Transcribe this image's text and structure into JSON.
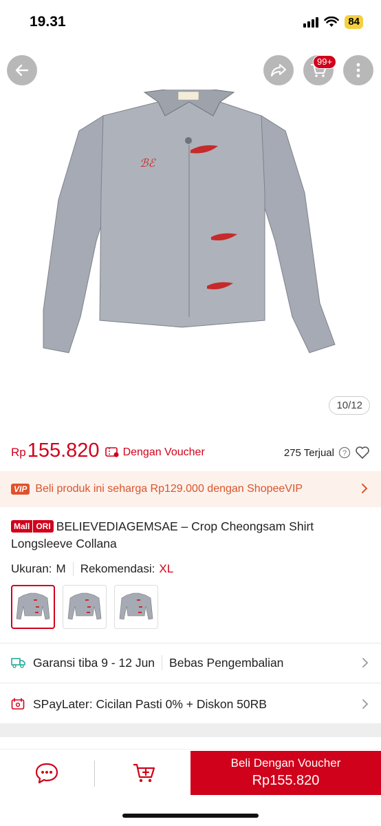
{
  "status": {
    "time": "19.31",
    "battery": "84"
  },
  "header": {
    "cart_badge": "99+",
    "image_counter": "10/12"
  },
  "price": {
    "currency": "Rp",
    "value": "155.820",
    "voucher_label": "Dengan Voucher",
    "sold": "275 Terjual"
  },
  "vip": {
    "tag": "VIP",
    "text": "Beli produk ini seharga Rp129.000 dengan ShopeeVIP"
  },
  "product": {
    "badge_mall": "Mall",
    "badge_ori": "ORI",
    "title": "BELIEVEDIAGEMSAE – Crop Cheongsam Shirt Longsleeve Collana"
  },
  "size": {
    "label": "Ukuran:",
    "value": "M",
    "rec_label": "Rekomendasi:",
    "rec_value": "XL"
  },
  "shipping": {
    "text": "Garansi tiba 9 - 12 Jun",
    "returns": "Bebas Pengembalian"
  },
  "paylater": {
    "text": "SPayLater: Cicilan Pasti 0% + Diskon 50RB"
  },
  "bottom": {
    "buy_label": "Beli Dengan Voucher",
    "buy_price": "Rp155.820"
  },
  "colors": {
    "accent": "#d0011b",
    "vip_bg": "#fdf1ec",
    "vip_text": "#d9552b"
  }
}
